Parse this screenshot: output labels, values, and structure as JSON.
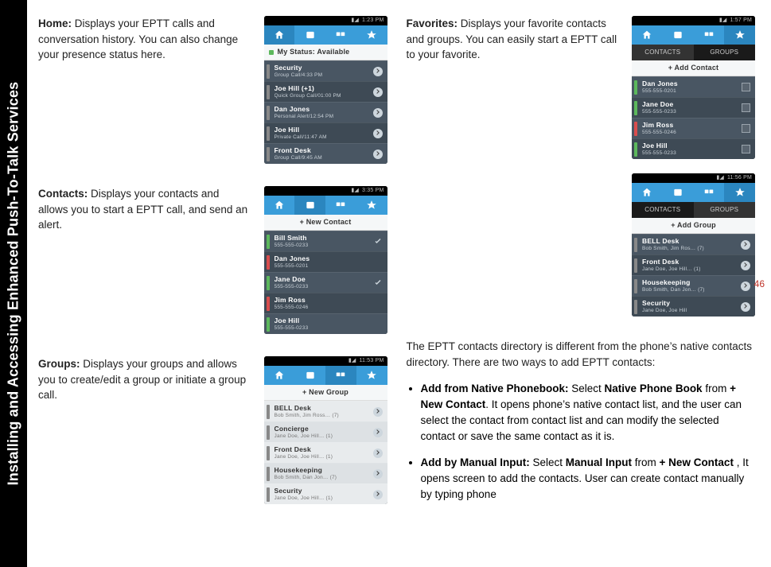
{
  "sidebar_title": "Installing and Accessing Enhanced Push-To-Talk Services",
  "page_number": "46",
  "sections": {
    "home": {
      "title": "Home:",
      "body": "Displays your EPTT calls and conversation history. You can also change your presence status here."
    },
    "contacts": {
      "title": "Contacts:",
      "body": "Displays your contacts and allows you to start a EPTT call, and send an alert."
    },
    "groups": {
      "title": "Groups:",
      "body": "Displays your groups and allows you to create/edit a group or initiate a group call."
    },
    "favorites": {
      "title": "Favorites:",
      "body": "Displays your favorite contacts and groups. You can easily start a EPTT call to your favorite."
    }
  },
  "screens": {
    "home": {
      "time": "1:23 PM",
      "status": "My Status: Available",
      "rows": [
        {
          "t1": "Security",
          "t2": "Group Call/4:33 PM",
          "chip": "grey"
        },
        {
          "t1": "Joe Hill (+1)",
          "t2": "Quick Group Call/01:00 PM",
          "chip": "grey"
        },
        {
          "t1": "Dan Jones",
          "t2": "Personal Alert/12:54 PM",
          "chip": "grey"
        },
        {
          "t1": "Joe Hill",
          "t2": "Private Call/11:47 AM",
          "chip": "grey"
        },
        {
          "t1": "Front Desk",
          "t2": "Group Call/9:45 AM",
          "chip": "grey"
        }
      ]
    },
    "contacts": {
      "time": "3:35 PM",
      "header": "+ New Contact",
      "rows": [
        {
          "t1": "Bill Smith",
          "t2": "555-555-0233",
          "chip": "green",
          "tick": true
        },
        {
          "t1": "Dan Jones",
          "t2": "555-555-0201",
          "chip": "red"
        },
        {
          "t1": "Jane Doe",
          "t2": "555-555-0233",
          "chip": "green",
          "tick": true
        },
        {
          "t1": "Jim Ross",
          "t2": "555-555-0246",
          "chip": "red"
        },
        {
          "t1": "Joe Hill",
          "t2": "555-555-0233",
          "chip": "green"
        }
      ]
    },
    "groups": {
      "time": "11:53 PM",
      "header": "+ New Group",
      "rows": [
        {
          "t1": "BELL Desk",
          "t2": "Bob Smith, Jim Ross… (7)"
        },
        {
          "t1": "Concierge",
          "t2": "Jane Doe, Joe Hill… (1)"
        },
        {
          "t1": "Front Desk",
          "t2": "Jane Doe, Joe Hill… (1)"
        },
        {
          "t1": "Housekeeping",
          "t2": "Bob Smith, Dan Jon… (7)"
        },
        {
          "t1": "Security",
          "t2": "Jane Doe, Joe Hill… (1)"
        }
      ]
    },
    "fav_contacts": {
      "time": "1:57 PM",
      "tabs": {
        "left": "CONTACTS",
        "right": "GROUPS"
      },
      "header": "+ Add Contact",
      "rows": [
        {
          "t1": "Dan Jones",
          "t2": "555-555-0201",
          "chip": "green"
        },
        {
          "t1": "Jane Doe",
          "t2": "555-555-0233",
          "chip": "green"
        },
        {
          "t1": "Jim Ross",
          "t2": "555-555-0246",
          "chip": "red"
        },
        {
          "t1": "Joe Hill",
          "t2": "555-555-0233",
          "chip": "green"
        }
      ]
    },
    "fav_groups": {
      "time": "11:56 PM",
      "tabs": {
        "left": "CONTACTS",
        "right": "GROUPS"
      },
      "header": "+ Add Group",
      "rows": [
        {
          "t1": "BELL Desk",
          "t2": "Bob Smith, Jim Ros… (7)"
        },
        {
          "t1": "Front Desk",
          "t2": "Jane Doe, Joe Hill… (1)"
        },
        {
          "t1": "Housekeeping",
          "t2": "Bob Smith, Dan Jon… (7)"
        },
        {
          "t1": "Security",
          "t2": "Jane Doe, Joe Hill"
        }
      ]
    }
  },
  "right_text": {
    "intro": "The EPTT contacts directory is different from the phone’s native contacts directory. There are two ways to add EPTT contacts:",
    "b1_bold": "Add from Native Phonebook: ",
    "b1_select": "Select ",
    "b1_link": "Native Phone Book",
    "b1_from": " from ",
    "b1_link2": "+ New Contact",
    "b1_body": ". It opens phone’s native contact list, and the user can select the contact from contact list and can modify the selected contact or save the same contact as it is.",
    "b2_bold": "Add by Manual Input: ",
    "b2_select": "Select ",
    "b2_link": "Manual Input",
    "b2_from": " from ",
    "b2_link2": "+ New Contact",
    "b2_body": " , It opens screen to add the contacts. User can create contact manually by typing phone"
  }
}
